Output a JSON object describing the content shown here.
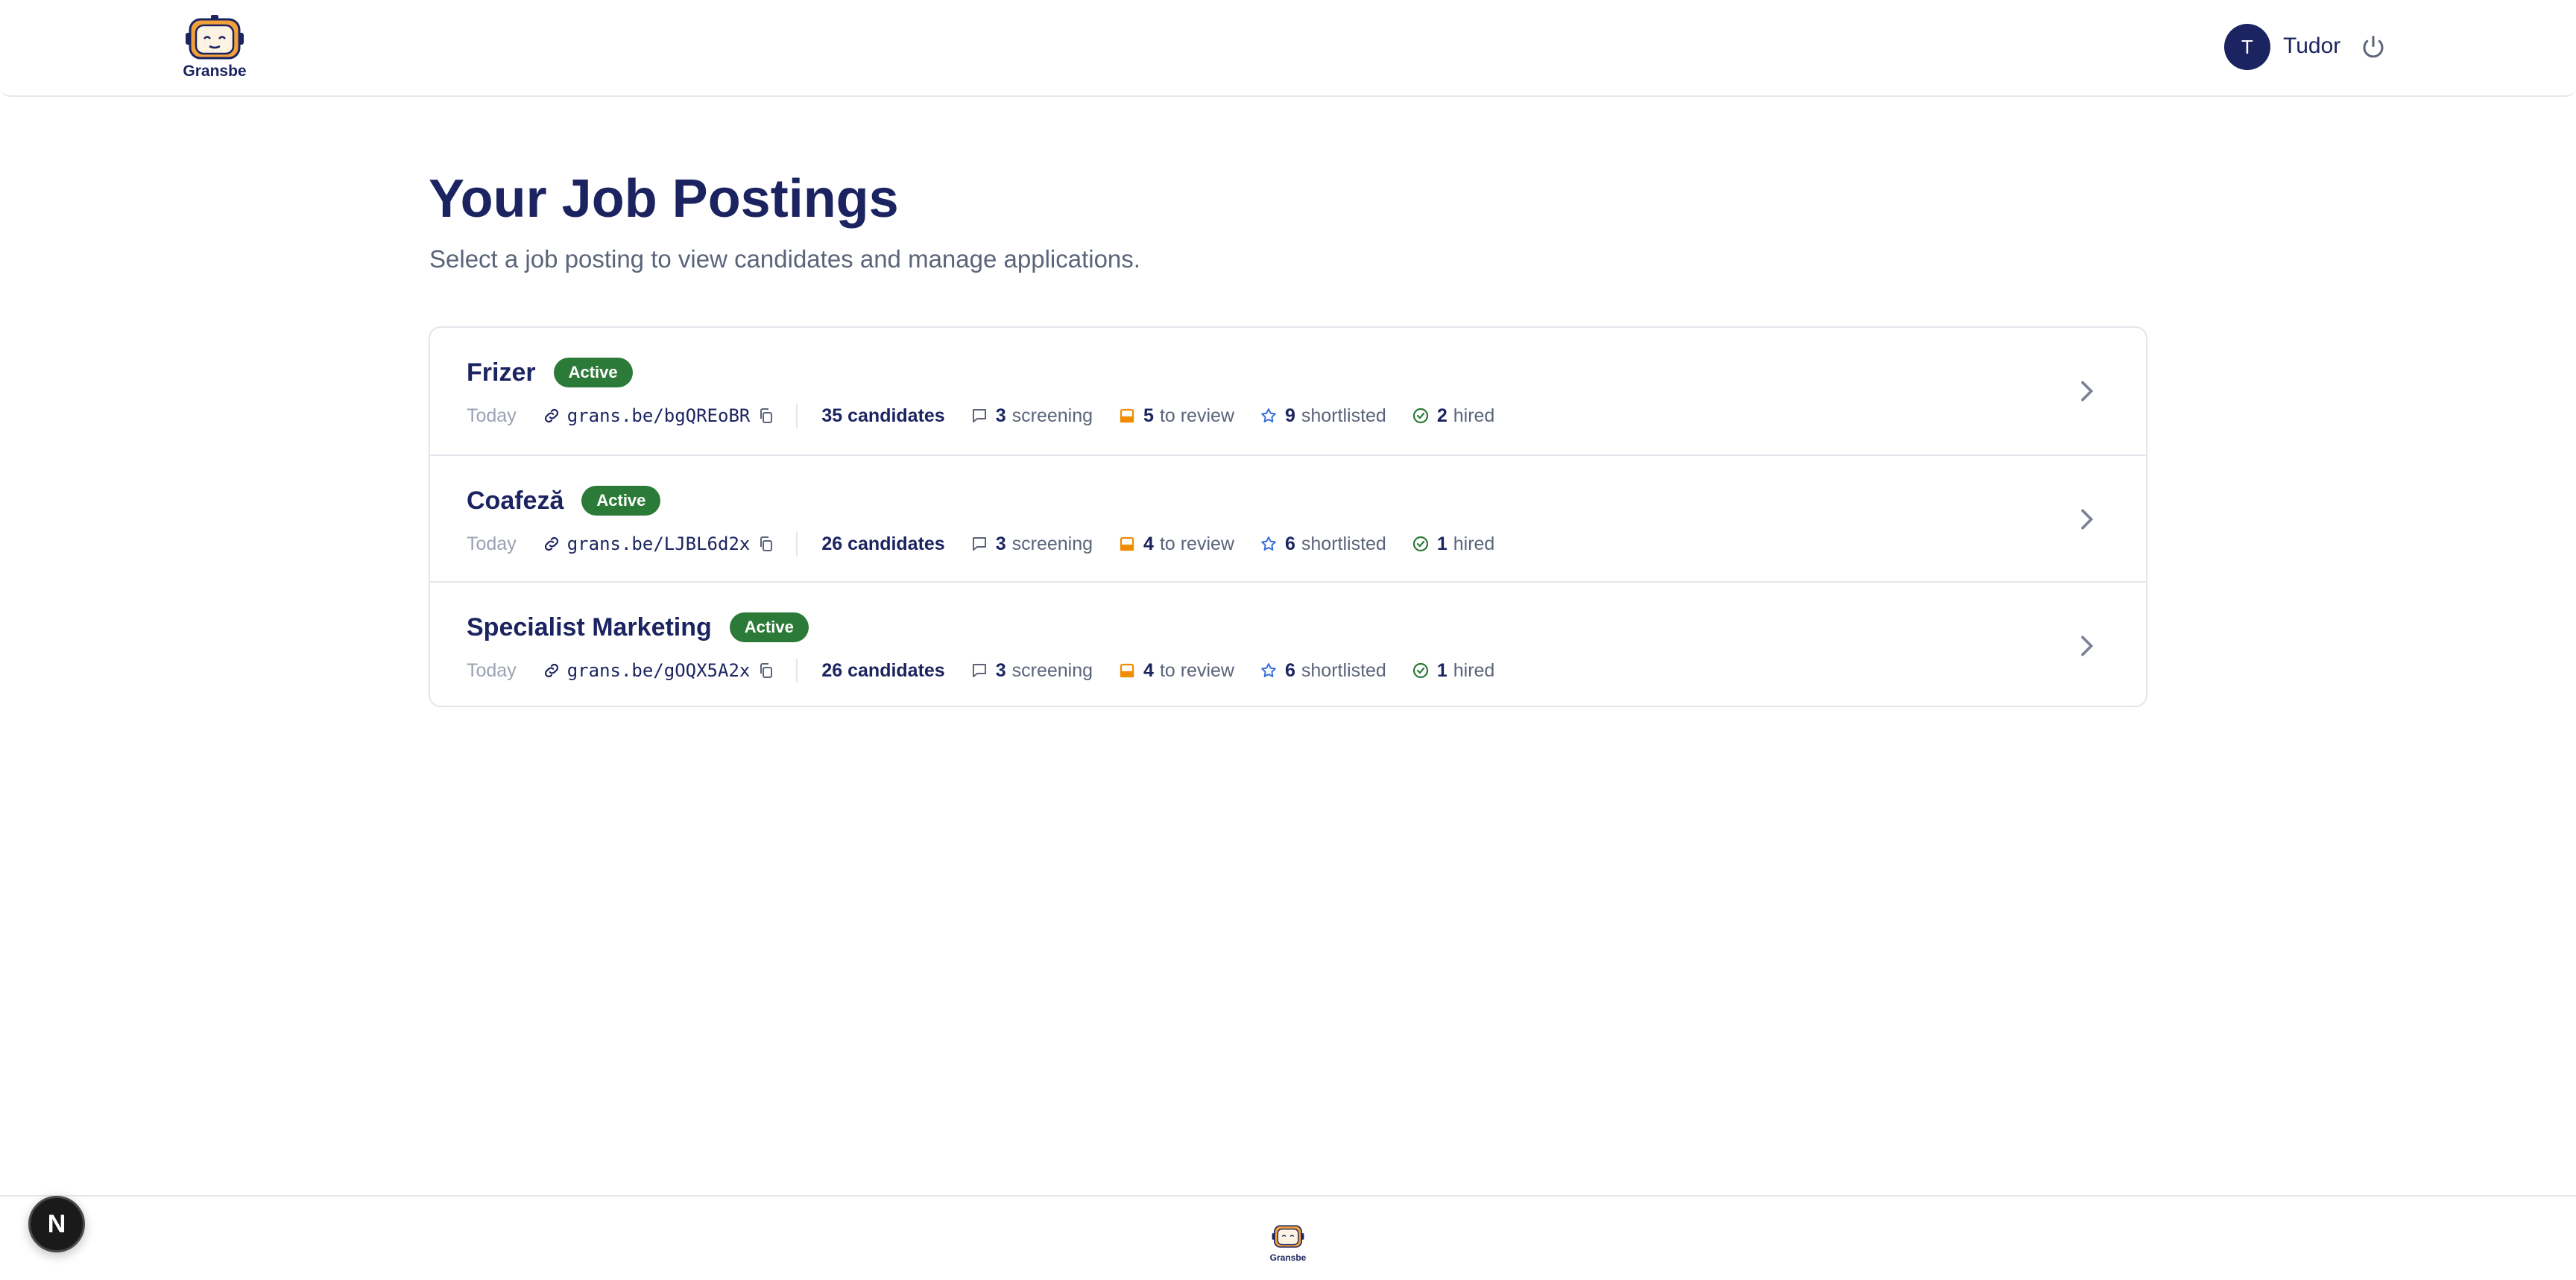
{
  "header": {
    "logo_text": "Gransbe",
    "user_initial": "T",
    "user_name": "Tudor"
  },
  "main": {
    "title": "Your Job Postings",
    "subtitle": "Select a job posting to view candidates and manage applications."
  },
  "jobs": [
    {
      "title": "Frizer",
      "status": "Active",
      "date": "Today",
      "link": "grans.be/bgQREoBR",
      "candidates": "35 candidates",
      "screening_count": "3",
      "screening_label": "screening",
      "review_count": "5",
      "review_label": "to review",
      "shortlisted_count": "9",
      "shortlisted_label": "shortlisted",
      "hired_count": "2",
      "hired_label": "hired"
    },
    {
      "title": "Coafeză",
      "status": "Active",
      "date": "Today",
      "link": "grans.be/LJBL6d2x",
      "candidates": "26 candidates",
      "screening_count": "3",
      "screening_label": "screening",
      "review_count": "4",
      "review_label": "to review",
      "shortlisted_count": "6",
      "shortlisted_label": "shortlisted",
      "hired_count": "1",
      "hired_label": "hired"
    },
    {
      "title": "Specialist Marketing",
      "status": "Active",
      "date": "Today",
      "link": "grans.be/gOQX5A2x",
      "candidates": "26 candidates",
      "screening_count": "3",
      "screening_label": "screening",
      "review_count": "4",
      "review_label": "to review",
      "shortlisted_count": "6",
      "shortlisted_label": "shortlisted",
      "hired_count": "1",
      "hired_label": "hired"
    }
  ],
  "footer": {
    "logo_text": "Gransbe",
    "dev_badge": "N"
  },
  "colors": {
    "navy": "#1b2460",
    "active_badge": "#2c7a37",
    "review_icon": "#f08c00",
    "shortlist_icon": "#3a6fd8",
    "hired_icon": "#2c7a37"
  }
}
